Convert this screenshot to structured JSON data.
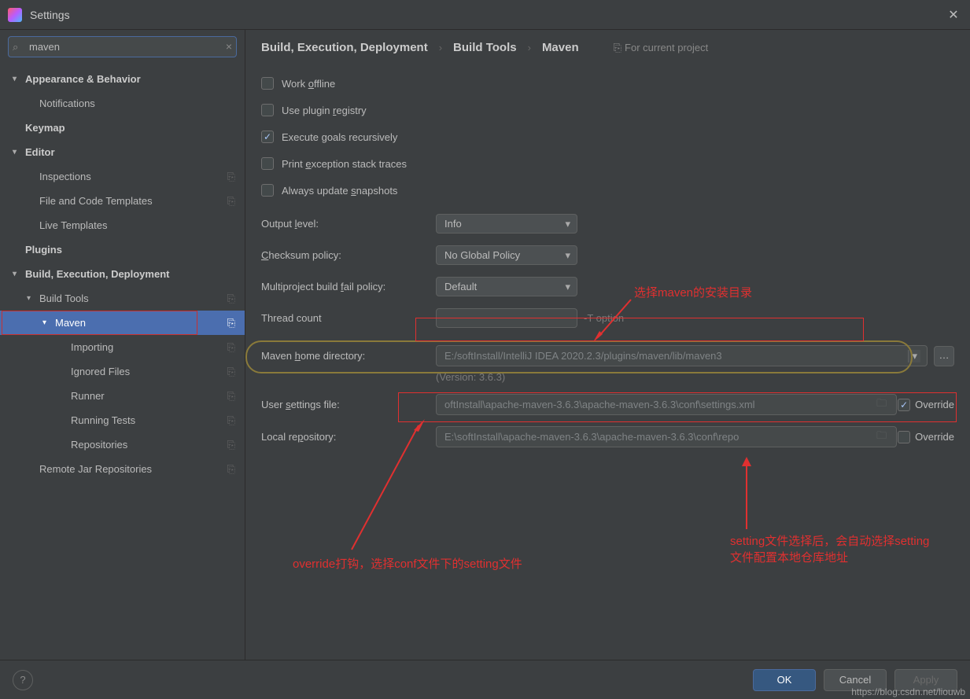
{
  "window": {
    "title": "Settings"
  },
  "search": {
    "value": "maven"
  },
  "sidebar": {
    "items": [
      {
        "label": "Appearance & Behavior",
        "bold": true,
        "chev": "▾",
        "depth": 0
      },
      {
        "label": "Notifications",
        "depth": 1
      },
      {
        "label": "Keymap",
        "bold": true,
        "depth": 0
      },
      {
        "label": "Editor",
        "bold": true,
        "chev": "▾",
        "depth": 0
      },
      {
        "label": "Inspections",
        "depth": 1,
        "cfg": true
      },
      {
        "label": "File and Code Templates",
        "depth": 1,
        "cfg": true
      },
      {
        "label": "Live Templates",
        "depth": 1
      },
      {
        "label": "Plugins",
        "bold": true,
        "depth": 0
      },
      {
        "label": "Build, Execution, Deployment",
        "bold": true,
        "chev": "▾",
        "depth": 0
      },
      {
        "label": "Build Tools",
        "depth": 1,
        "chev": "▾",
        "cfg": true
      },
      {
        "label": "Maven",
        "depth": 2,
        "chev": "▾",
        "cfg": true,
        "selected": true,
        "redbox": true
      },
      {
        "label": "Importing",
        "depth": 3,
        "cfg": true
      },
      {
        "label": "Ignored Files",
        "depth": 3,
        "cfg": true
      },
      {
        "label": "Runner",
        "depth": 3,
        "cfg": true
      },
      {
        "label": "Running Tests",
        "depth": 3,
        "cfg": true
      },
      {
        "label": "Repositories",
        "depth": 3,
        "cfg": true
      },
      {
        "label": "Remote Jar Repositories",
        "depth": 1,
        "cfg": true
      }
    ]
  },
  "breadcrumb": {
    "a": "Build, Execution, Deployment",
    "b": "Build Tools",
    "c": "Maven",
    "proj": "For current project"
  },
  "checks": {
    "work_offline": "Work offline",
    "plugin_registry": "Use plugin registry",
    "exec_recursive": "Execute goals recursively",
    "print_exception": "Print exception stack traces",
    "always_update": "Always update snapshots"
  },
  "fields": {
    "output_level_label": "Output level:",
    "output_level_value": "Info",
    "checksum_label": "Checksum policy:",
    "checksum_value": "No Global Policy",
    "fail_label": "Multiproject build fail policy:",
    "fail_value": "Default",
    "thread_label": "Thread count",
    "thread_hint": "-T option",
    "home_label": "Maven home directory:",
    "home_value": "E:/softInstall/IntelliJ IDEA 2020.2.3/plugins/maven/lib/maven3",
    "version": "(Version: 3.6.3)",
    "settings_label": "User settings file:",
    "settings_value": "oftInstall\\apache-maven-3.6.3\\apache-maven-3.6.3\\conf\\settings.xml",
    "repo_label": "Local repository:",
    "repo_value": "E:\\softInstall\\apache-maven-3.6.3\\apache-maven-3.6.3\\conf\\repo",
    "override": "Override"
  },
  "annotations": {
    "a1": "选择maven的安装目录",
    "a2": "override打钩，选择conf文件下的setting文件",
    "a3": "setting文件选择后，会自动选择setting文件配置本地仓库地址"
  },
  "footer": {
    "ok": "OK",
    "cancel": "Cancel",
    "apply": "Apply"
  },
  "watermark": "https://blog.csdn.net/liouwb"
}
